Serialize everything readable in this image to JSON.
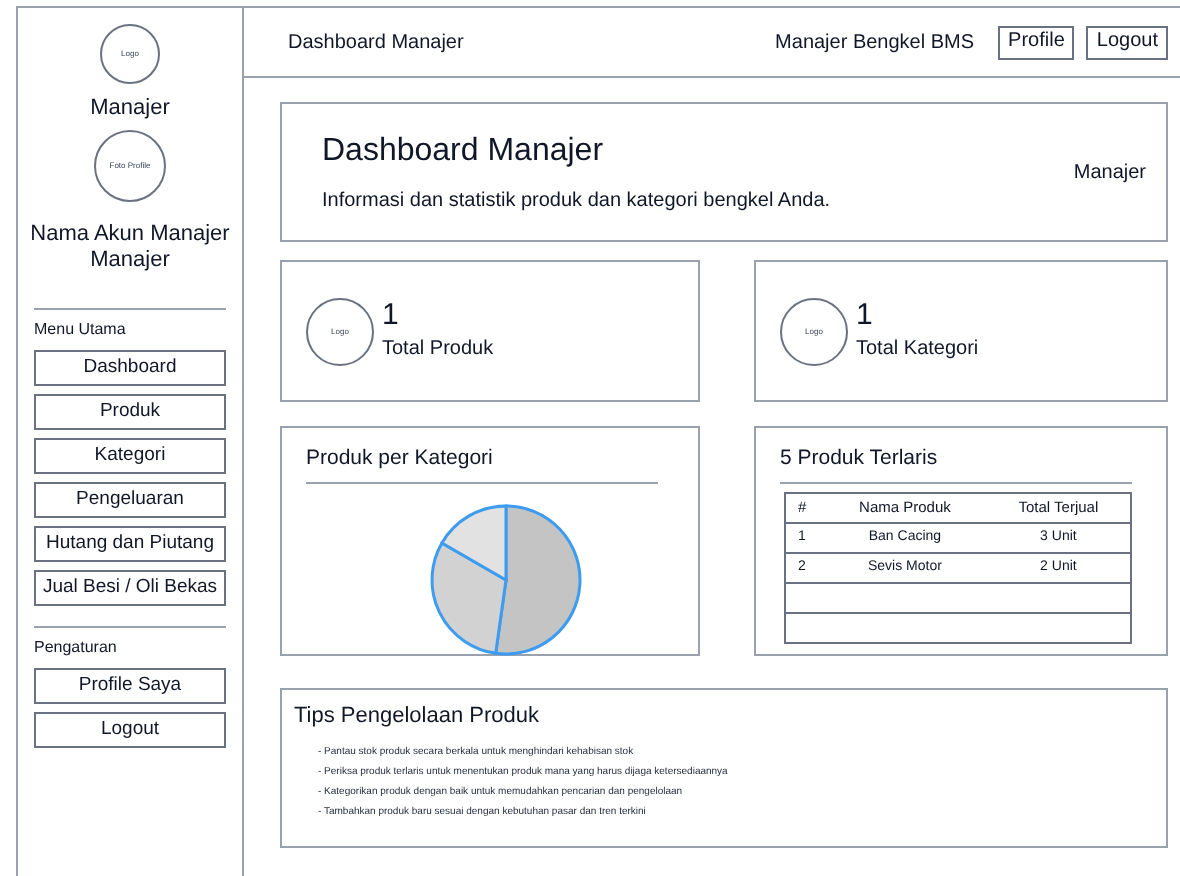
{
  "sidebar": {
    "logo": "Logo",
    "role": "Manajer",
    "photo": "Foto Profile",
    "account_name": "Nama Akun Manajer",
    "account_role": "Manajer",
    "sections": [
      {
        "title": "Menu Utama",
        "items": [
          "Dashboard",
          "Produk",
          "Kategori",
          "Pengeluaran",
          "Hutang dan Piutang",
          "Jual Besi / Oli Bekas"
        ]
      },
      {
        "title": "Pengaturan",
        "items": [
          "Profile Saya",
          "Logout"
        ]
      }
    ]
  },
  "header": {
    "title": "Dashboard Manajer",
    "user": "Manajer Bengkel BMS",
    "buttons": [
      "Profile",
      "Logout"
    ]
  },
  "welcome": {
    "title": "Dashboard Manajer",
    "subtitle": "Informasi dan statistik produk dan kategori bengkel Anda.",
    "role": "Manajer"
  },
  "stats": [
    {
      "logo": "Logo",
      "value": "1",
      "label": "Total Produk"
    },
    {
      "logo": "Logo",
      "value": "1",
      "label": "Total Kategori"
    }
  ],
  "category_chart": {
    "title": "Produk per Kategori"
  },
  "top_products": {
    "title": "5 Produk Terlaris",
    "columns": [
      "#",
      "Nama Produk",
      "Total Terjual"
    ],
    "rows": [
      [
        "1",
        "Ban Cacing",
        "3 Unit"
      ],
      [
        "2",
        "Sevis Motor",
        "2 Unit"
      ]
    ]
  },
  "tips": {
    "title": "Tips Pengelolaan Produk",
    "items": [
      "- Pantau stok produk secara berkala untuk menghindari kehabisan stok",
      "- Periksa produk terlaris untuk menentukan produk mana yang harus dijaga ketersediaannya",
      "- Kategorikan produk dengan baik untuk memudahkan pencarian dan pengelolaan",
      "- Tambahkan produk baru sesuai dengan kebutuhan pasar dan tren terkini"
    ]
  }
}
